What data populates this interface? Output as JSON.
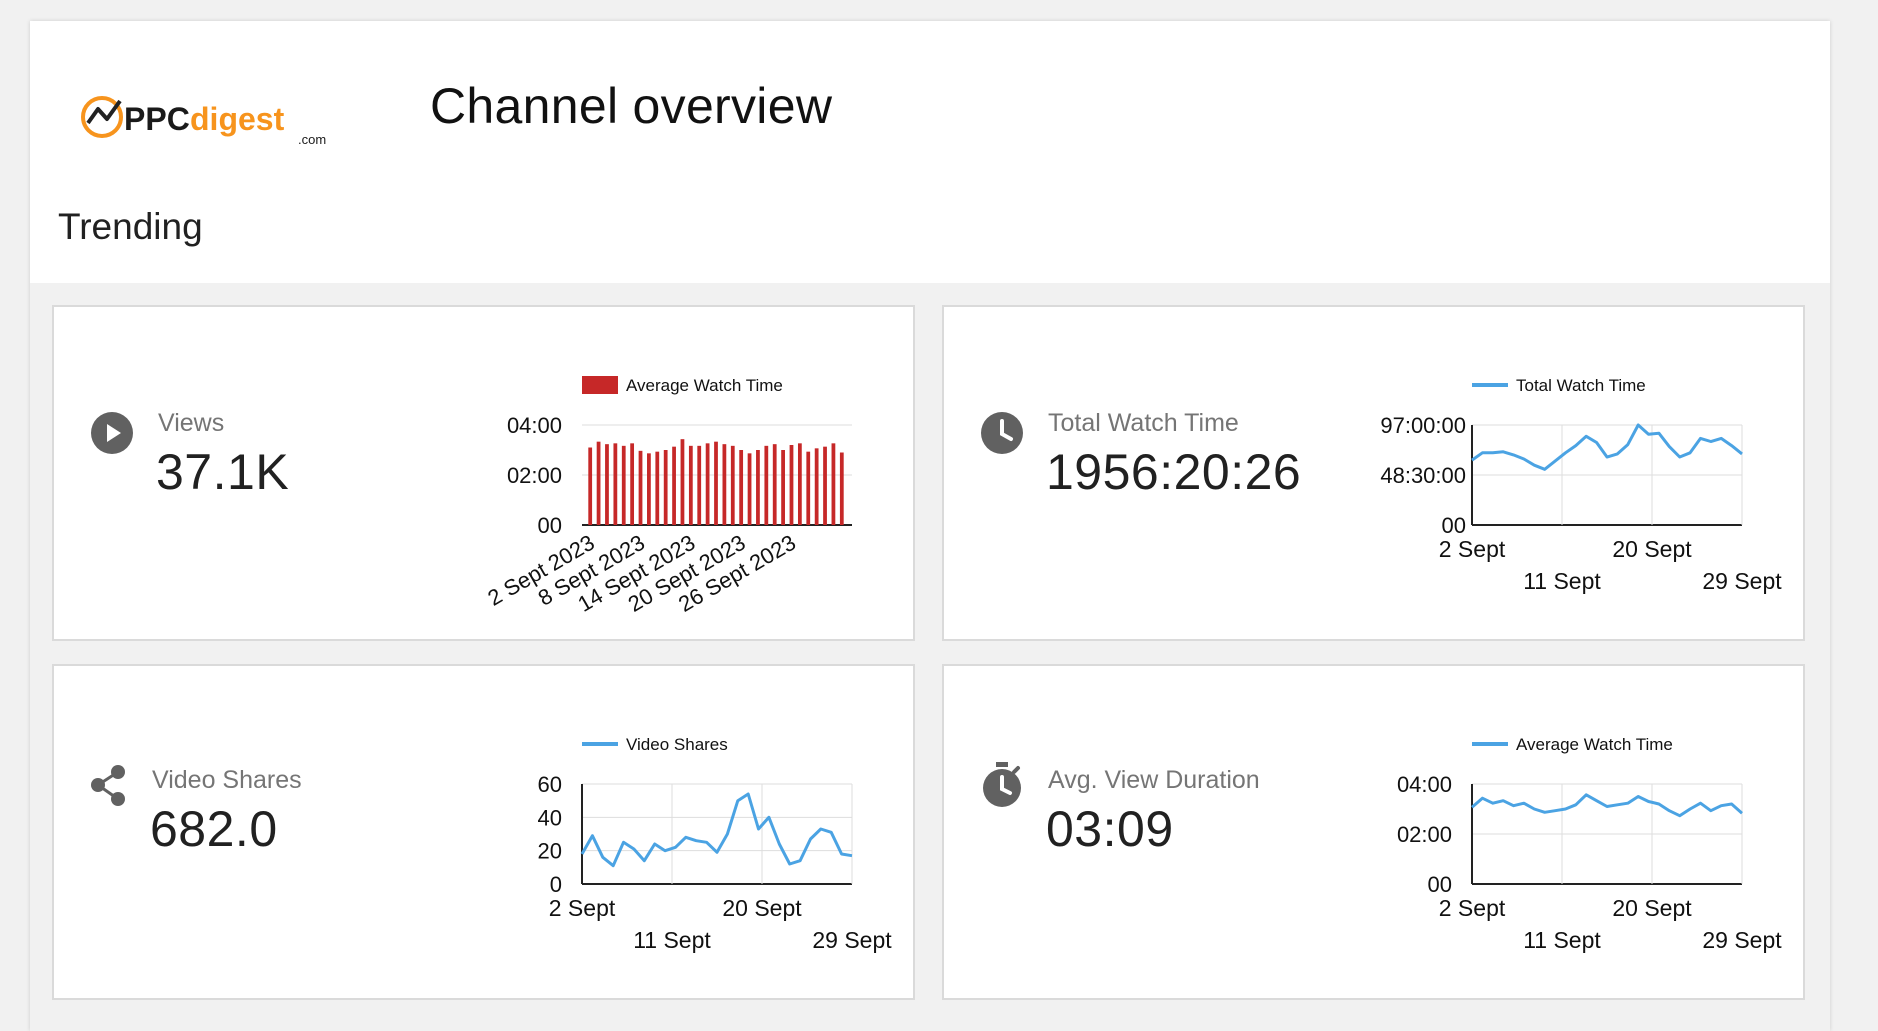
{
  "header": {
    "logo_text": "PPCdigest",
    "logo_suffix": ".com",
    "title": "Channel overview",
    "section": "Trending"
  },
  "colors": {
    "accent_orange": "#f7941d",
    "bar_red": "#c62828",
    "line_blue": "#4ba3e3",
    "icon_grey": "#616161"
  },
  "cards": {
    "views": {
      "icon": "play-circle-icon",
      "label": "Views",
      "value": "37.1K",
      "chart": {
        "legend": "Average Watch Time",
        "y_ticks": [
          "04:00",
          "02:00",
          "00"
        ],
        "x_ticks": [
          "2 Sept 2023",
          "8 Sept 2023",
          "14 Sept 2023",
          "20 Sept 2023",
          "26 Sept 2023"
        ]
      }
    },
    "total_watch_time": {
      "icon": "clock-icon",
      "label": "Total Watch Time",
      "value": "1956:20:26",
      "chart": {
        "legend": "Total Watch Time",
        "y_ticks": [
          "97:00:00",
          "48:30:00",
          "00"
        ],
        "x_ticks": [
          "2 Sept",
          "11 Sept",
          "20 Sept",
          "29 Sept"
        ]
      }
    },
    "video_shares": {
      "icon": "share-icon",
      "label": "Video Shares",
      "value": "682.0",
      "chart": {
        "legend": "Video Shares",
        "y_ticks": [
          "60",
          "40",
          "20",
          "0"
        ],
        "x_ticks": [
          "2 Sept",
          "11 Sept",
          "20 Sept",
          "29 Sept"
        ]
      }
    },
    "avg_view_duration": {
      "icon": "stopwatch-icon",
      "label": "Avg. View Duration",
      "value": "03:09",
      "chart": {
        "legend": "Average Watch Time",
        "y_ticks": [
          "04:00",
          "02:00",
          "00"
        ],
        "x_ticks": [
          "2 Sept",
          "11 Sept",
          "20 Sept",
          "29 Sept"
        ]
      }
    }
  },
  "chart_data": [
    {
      "type": "bar",
      "legend": "Average Watch Time",
      "y_unit": "minutes",
      "ylim": [
        0,
        240
      ],
      "y_ticks": [
        "04:00",
        "02:00",
        "00"
      ],
      "x_ticks": [
        "2 Sept 2023",
        "8 Sept 2023",
        "14 Sept 2023",
        "20 Sept 2023",
        "26 Sept 2023"
      ],
      "values": [
        186,
        200,
        194,
        196,
        190,
        196,
        178,
        172,
        176,
        180,
        188,
        206,
        190,
        190,
        196,
        200,
        194,
        190,
        180,
        172,
        180,
        190,
        194,
        180,
        192,
        196,
        176,
        184,
        188,
        196,
        174
      ]
    },
    {
      "type": "line",
      "legend": "Total Watch Time",
      "y_unit": "hours",
      "ylim": [
        0,
        97
      ],
      "y_ticks": [
        "97:00:00",
        "48:30:00",
        "00"
      ],
      "x_ticks": [
        "2 Sept",
        "11 Sept",
        "20 Sept",
        "29 Sept"
      ],
      "values": [
        63,
        70,
        70,
        71,
        68,
        64,
        58,
        54,
        62,
        70,
        77,
        86,
        80,
        66,
        69,
        78,
        97,
        88,
        89,
        76,
        66,
        70,
        84,
        81,
        84,
        77,
        69
      ]
    },
    {
      "type": "line",
      "legend": "Video Shares",
      "ylim": [
        0,
        60
      ],
      "y_ticks": [
        "60",
        "40",
        "20",
        "0"
      ],
      "x_ticks": [
        "2 Sept",
        "11 Sept",
        "20 Sept",
        "29 Sept"
      ],
      "values": [
        18,
        29,
        16,
        11,
        25,
        21,
        14,
        24,
        20,
        22,
        28,
        26,
        25,
        19,
        30,
        50,
        54,
        33,
        40,
        24,
        12,
        14,
        27,
        33,
        31,
        18,
        17
      ]
    },
    {
      "type": "line",
      "legend": "Average Watch Time",
      "y_unit": "minutes",
      "ylim": [
        0,
        240
      ],
      "y_ticks": [
        "04:00",
        "02:00",
        "00"
      ],
      "x_ticks": [
        "2 Sept",
        "11 Sept",
        "20 Sept",
        "29 Sept"
      ],
      "values": [
        184,
        206,
        194,
        200,
        188,
        194,
        180,
        172,
        176,
        180,
        190,
        214,
        200,
        186,
        190,
        194,
        210,
        198,
        192,
        176,
        164,
        180,
        194,
        176,
        188,
        192,
        170
      ]
    }
  ]
}
